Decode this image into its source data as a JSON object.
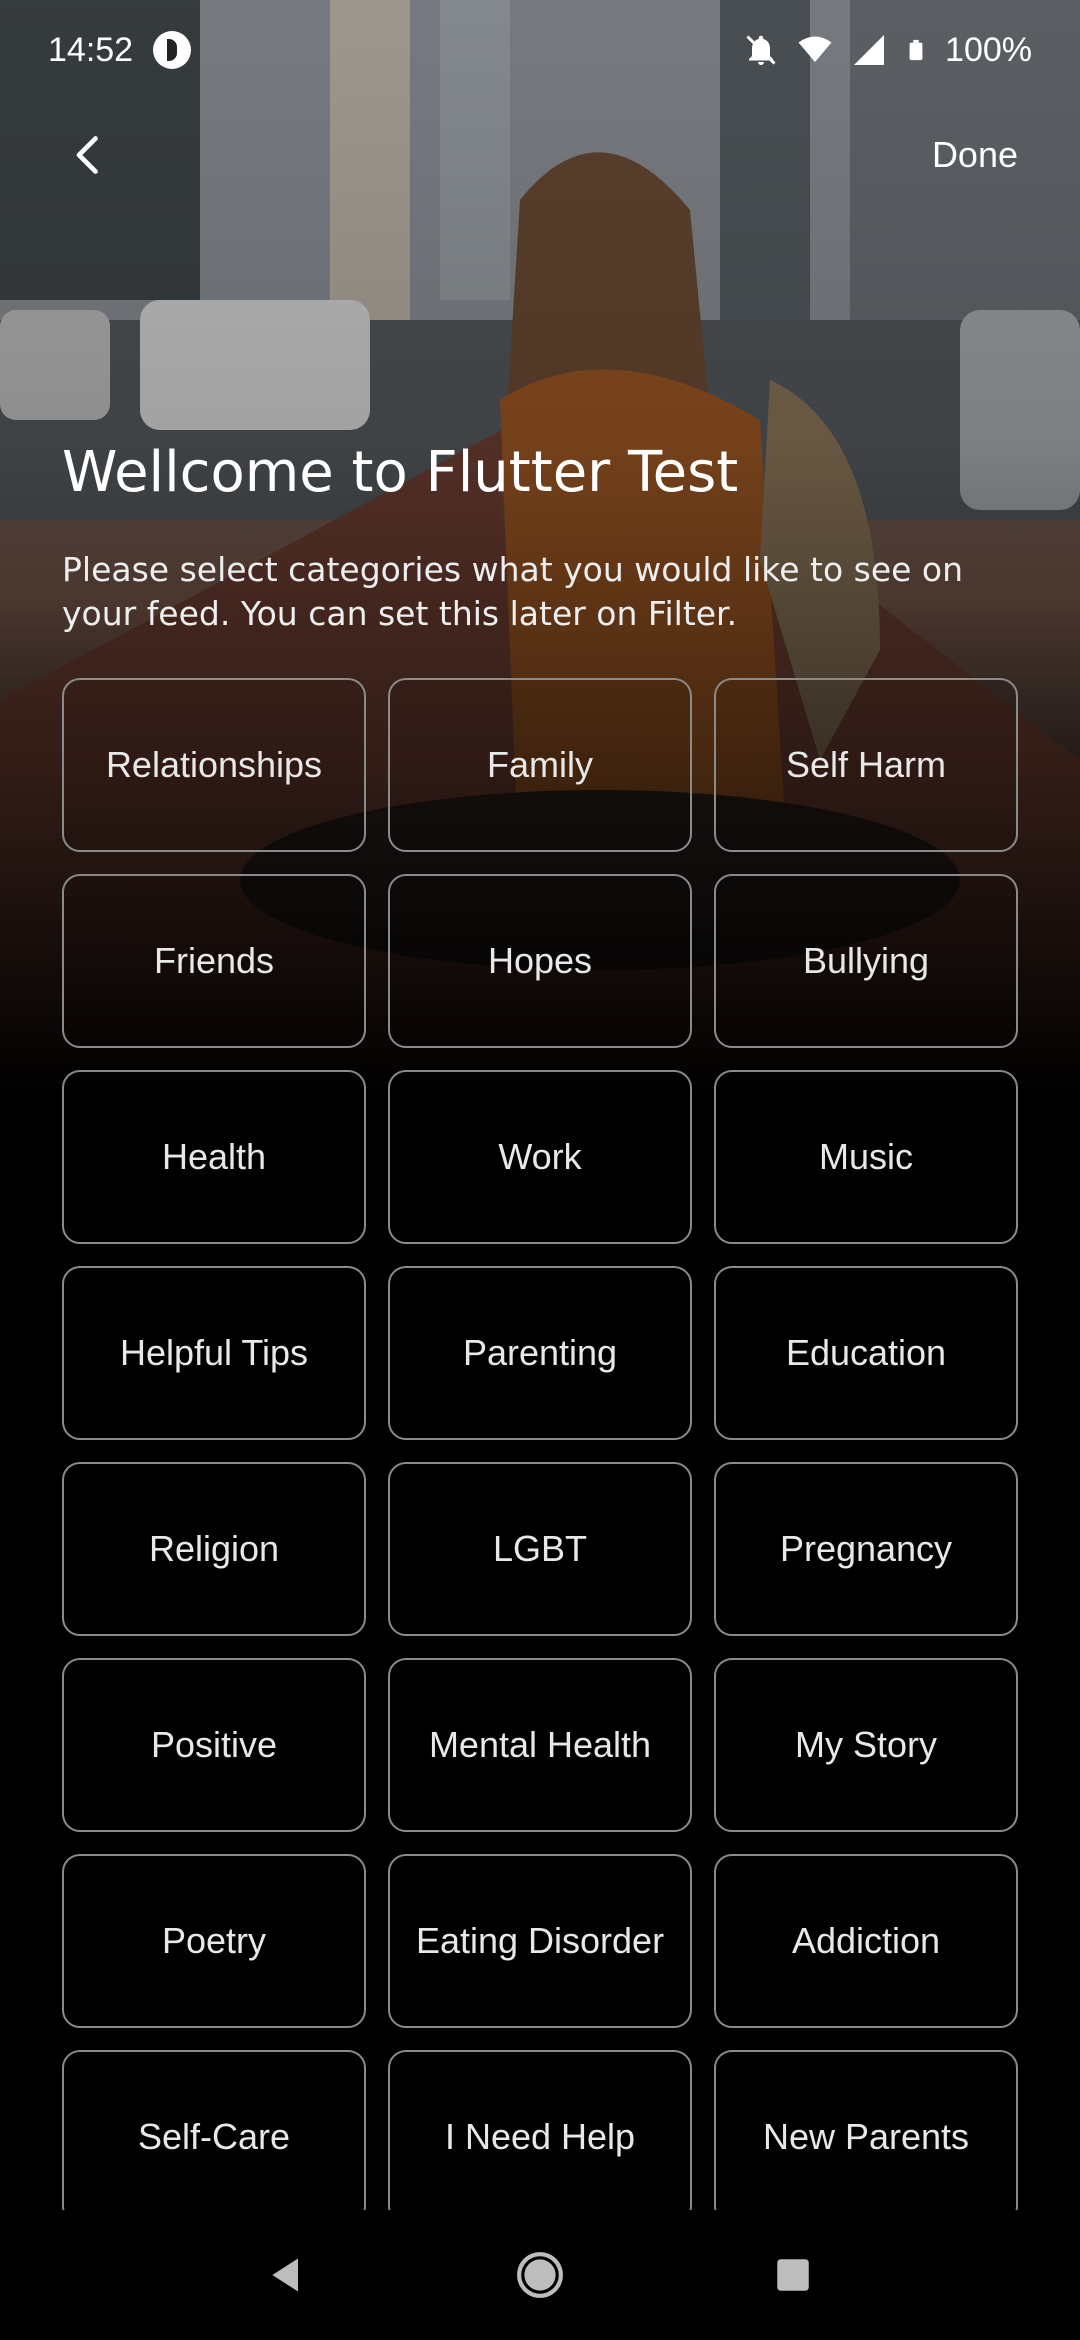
{
  "status_bar": {
    "time": "14:52",
    "battery": "100%",
    "icons": [
      "app-notification-icon",
      "mute-icon",
      "wifi-icon",
      "signal-icon",
      "battery-icon"
    ]
  },
  "app_bar": {
    "back_icon": "back-arrow-icon",
    "done_label": "Done"
  },
  "welcome": {
    "title": "Wellcome to Flutter Test",
    "subtitle": "Please select categories what you would like to see on your feed. You can set this later on Filter."
  },
  "categories": [
    "Relationships",
    "Family",
    "Self Harm",
    "Friends",
    "Hopes",
    "Bullying",
    "Health",
    "Work",
    "Music",
    "Helpful Tips",
    "Parenting",
    "Education",
    "Religion",
    "LGBT",
    "Pregnancy",
    "Positive",
    "Mental Health",
    "My Story",
    "Poetry",
    "Eating Disorder",
    "Addiction",
    "Self-Care",
    "I Need Help",
    "New Parents"
  ],
  "nav_bar": {
    "icons": [
      "nav-back-icon",
      "nav-home-icon",
      "nav-recents-icon"
    ]
  },
  "colors": {
    "background": "#000000",
    "tile_border": "#8a8a8a",
    "text": "#ffffff"
  }
}
